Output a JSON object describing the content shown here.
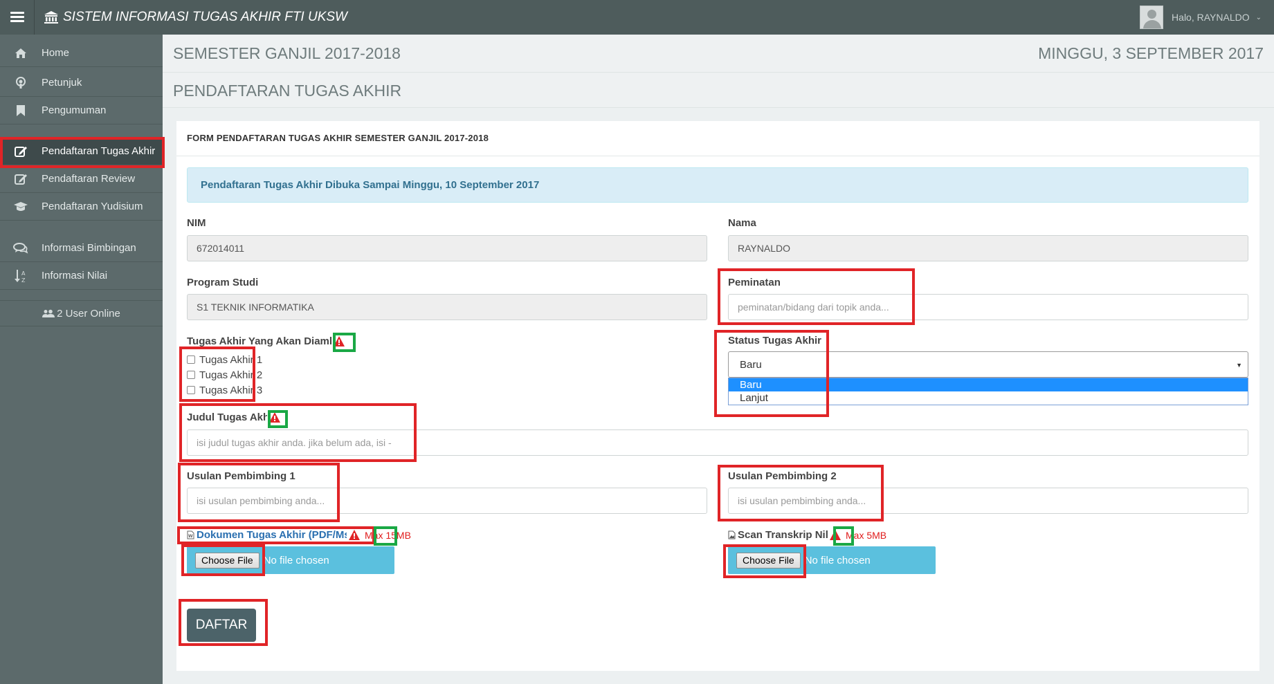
{
  "app": {
    "title": "SISTEM INFORMASI TUGAS AKHIR FTI UKSW",
    "greeting": "Halo, RAYNALDO"
  },
  "sidebar": {
    "items": [
      {
        "label": "Home",
        "icon": "home-icon"
      },
      {
        "label": "Petunjuk",
        "icon": "podcast-icon"
      },
      {
        "label": "Pengumuman",
        "icon": "bookmark-icon"
      },
      {
        "label": "Pendaftaran Tugas Akhir",
        "icon": "edit-icon",
        "active": true
      },
      {
        "label": "Pendaftaran Review",
        "icon": "edit-icon"
      },
      {
        "label": "Pendaftaran Yudisium",
        "icon": "graduation-cap-icon"
      },
      {
        "label": "Informasi Bimbingan",
        "icon": "comments-icon"
      },
      {
        "label": "Informasi Nilai",
        "icon": "sort-alpha-icon"
      }
    ],
    "online": "2 User Online"
  },
  "header": {
    "semester": "SEMESTER GANJIL 2017-2018",
    "date": "MINGGU, 3 SEPTEMBER 2017",
    "page_title": "PENDAFTARAN TUGAS AKHIR"
  },
  "form": {
    "heading": "FORM PENDAFTARAN TUGAS AKHIR SEMESTER GANJIL 2017-2018",
    "alert": "Pendaftaran Tugas Akhir Dibuka Sampai Minggu, 10 September 2017",
    "nim": {
      "label": "NIM",
      "value": "672014011"
    },
    "nama": {
      "label": "Nama",
      "value": "RAYNALDO"
    },
    "prodi": {
      "label": "Program Studi",
      "value": "S1 TEKNIK INFORMATIKA"
    },
    "peminatan": {
      "label": "Peminatan",
      "placeholder": "peminatan/bidang dari topik anda..."
    },
    "tugas_akhir": {
      "label": "Tugas Akhir Yang Akan Diambil",
      "options": [
        "Tugas Akhir 1",
        "Tugas Akhir 2",
        "Tugas Akhir 3"
      ]
    },
    "status": {
      "label": "Status Tugas Akhir",
      "selected": "Baru",
      "options": [
        "Baru",
        "Lanjut"
      ]
    },
    "judul": {
      "label": "Judul Tugas Akhir",
      "placeholder": "isi judul tugas akhir anda. jika belum ada, isi -"
    },
    "pembimbing1": {
      "label": "Usulan Pembimbing 1",
      "placeholder": "isi usulan pembimbing anda..."
    },
    "pembimbing2": {
      "label": "Usulan Pembimbing 2",
      "placeholder": "isi usulan pembimbing anda..."
    },
    "dokumen": {
      "label": "Dokumen Tugas Akhir (PDF/Ms.Word)",
      "max": "Max 15MB"
    },
    "transkrip": {
      "label": "Scan Transkrip Nilai",
      "max": "Max 5MB"
    },
    "choose_file": "Choose File",
    "no_file": "No file chosen",
    "submit": "DAFTAR"
  },
  "colors": {
    "topbar": "#4e5c5c",
    "sidebar": "#5c6a6b",
    "alert_bg": "#d9edf7",
    "file_bar": "#5bc0de",
    "submit_bg": "#4c6369",
    "highlight_red": "#e02427",
    "highlight_green": "#1aa845"
  }
}
